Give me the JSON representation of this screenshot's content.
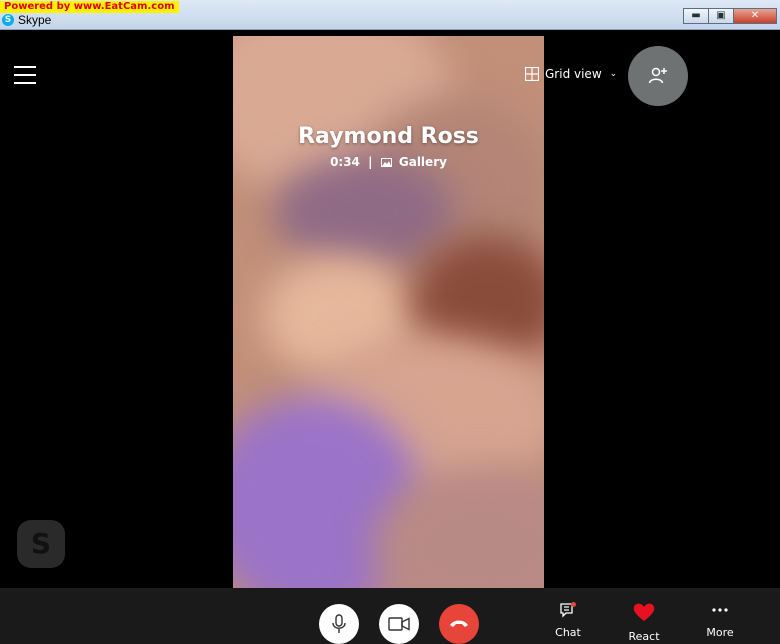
{
  "window": {
    "watermark": "Powered by www.EatCam.com",
    "title": "Skype",
    "app_icon_letter": "S",
    "minimize": "▬",
    "maximize": "▣",
    "close": "✕"
  },
  "call": {
    "caller_name": "Raymond Ross",
    "duration": "0:34",
    "separator": "|",
    "view_mode": "Gallery",
    "layout_label": "Grid view"
  },
  "icons": {
    "menu": "hamburger-menu-icon",
    "grid": "grid-icon",
    "add_person": "add-person-icon",
    "gallery": "gallery-icon",
    "mic": "microphone-icon",
    "video": "video-camera-icon",
    "hangup": "hang-up-icon",
    "chat": "chat-icon",
    "react": "heart-icon",
    "more": "more-icon"
  },
  "controls": {
    "chat_label": "Chat",
    "react_label": "React",
    "more_label": "More"
  },
  "logo_letter": "S",
  "colors": {
    "hangup": "#e8453a",
    "react": "#e81123",
    "add_person_bg": "#6e7272",
    "background": "#000000"
  }
}
